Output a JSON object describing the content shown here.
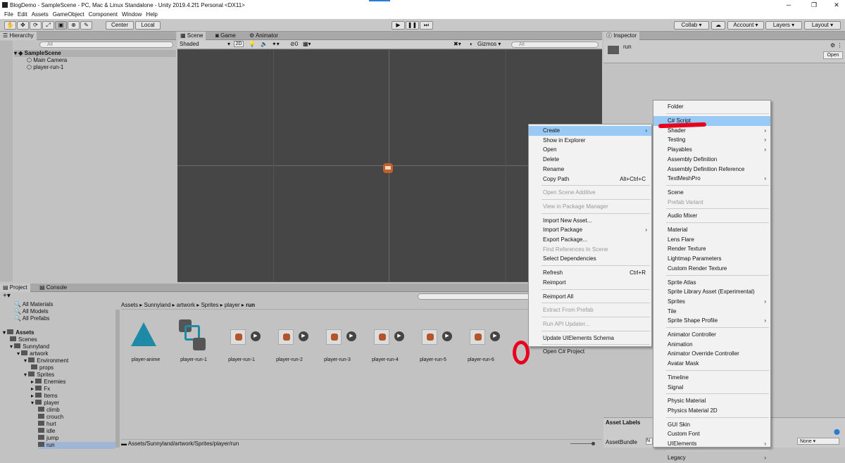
{
  "window": {
    "title": "BlogDemo - SampleScene - PC, Mac & Linux Standalone - Unity 2019.4.2f1 Personal <DX11>",
    "minimize": "─",
    "maximize": "❐",
    "close": "✕"
  },
  "menubar": [
    "File",
    "Edit",
    "Assets",
    "GameObject",
    "Component",
    "Window",
    "Help"
  ],
  "toolbar": {
    "center": "Center",
    "local": "Local",
    "collab": "Collab",
    "account": "Account",
    "layers": "Layers",
    "layout": "Layout"
  },
  "hierarchy": {
    "tab": "Hierarchy",
    "search": "All",
    "scene": "SampleScene",
    "items": [
      "Main Camera",
      "player-run-1"
    ]
  },
  "scene": {
    "tabs": [
      "Scene",
      "Game",
      "Animator"
    ],
    "shading": "Shaded",
    "mode2d": "2D",
    "gizmos": "Gizmos",
    "search": "All",
    "fx": "0"
  },
  "inspector": {
    "tab": "Inspector",
    "name": "run",
    "open": "Open",
    "asset_labels": "Asset Labels",
    "asset_bundle": "AssetBundle",
    "bundle_value": "None"
  },
  "project": {
    "tabs": [
      "Project",
      "Console"
    ],
    "favorites": [
      "All Materials",
      "All Models",
      "All Prefabs"
    ],
    "tree": [
      {
        "label": "Assets",
        "depth": 0
      },
      {
        "label": "Scenes",
        "depth": 1
      },
      {
        "label": "Sunnyland",
        "depth": 1
      },
      {
        "label": "artwork",
        "depth": 2
      },
      {
        "label": "Environment",
        "depth": 3
      },
      {
        "label": "props",
        "depth": 4
      },
      {
        "label": "Sprites",
        "depth": 3
      },
      {
        "label": "Enemies",
        "depth": 4
      },
      {
        "label": "Fx",
        "depth": 4
      },
      {
        "label": "Items",
        "depth": 4
      },
      {
        "label": "player",
        "depth": 4
      },
      {
        "label": "climb",
        "depth": 5
      },
      {
        "label": "crouch",
        "depth": 5
      },
      {
        "label": "hurt",
        "depth": 5
      },
      {
        "label": "idle",
        "depth": 5
      },
      {
        "label": "jump",
        "depth": 5
      },
      {
        "label": "run",
        "depth": 5
      }
    ],
    "breadcrumb": [
      "Assets",
      "Sunnyland",
      "artwork",
      "Sprites",
      "player",
      "run"
    ],
    "path": "Assets/Sunnyland/artwork/Sprites/player/run",
    "assets": [
      "player-anime",
      "player-run-1",
      "player-run-1",
      "player-run-2",
      "player-run-3",
      "player-run-4",
      "player-run-5",
      "player-run-6"
    ]
  },
  "context_menu": [
    {
      "label": "Create",
      "arrow": true,
      "hl": true
    },
    {
      "label": "Show in Explorer"
    },
    {
      "label": "Open"
    },
    {
      "label": "Delete"
    },
    {
      "label": "Rename"
    },
    {
      "label": "Copy Path",
      "shortcut": "Alt+Ctrl+C"
    },
    {
      "sep": true
    },
    {
      "label": "Open Scene Additive",
      "dis": true
    },
    {
      "sep": true
    },
    {
      "label": "View in Package Manager",
      "dis": true
    },
    {
      "sep": true
    },
    {
      "label": "Import New Asset..."
    },
    {
      "label": "Import Package",
      "arrow": true
    },
    {
      "label": "Export Package..."
    },
    {
      "label": "Find References In Scene",
      "dis": true
    },
    {
      "label": "Select Dependencies"
    },
    {
      "sep": true
    },
    {
      "label": "Refresh",
      "shortcut": "Ctrl+R"
    },
    {
      "label": "Reimport"
    },
    {
      "sep": true
    },
    {
      "label": "Reimport All"
    },
    {
      "sep": true
    },
    {
      "label": "Extract From Prefab",
      "dis": true
    },
    {
      "sep": true
    },
    {
      "label": "Run API Updater...",
      "dis": true
    },
    {
      "sep": true
    },
    {
      "label": "Update UIElements Schema"
    },
    {
      "sep": true
    },
    {
      "label": "Open C# Project"
    }
  ],
  "create_menu": [
    {
      "label": "Folder"
    },
    {
      "sep": true
    },
    {
      "label": "C# Script",
      "hl": true
    },
    {
      "label": "Shader",
      "arrow": true
    },
    {
      "label": "Testing",
      "arrow": true
    },
    {
      "label": "Playables",
      "arrow": true
    },
    {
      "label": "Assembly Definition"
    },
    {
      "label": "Assembly Definition Reference"
    },
    {
      "label": "TextMeshPro",
      "arrow": true
    },
    {
      "sep": true
    },
    {
      "label": "Scene"
    },
    {
      "label": "Prefab Variant",
      "dis": true
    },
    {
      "sep": true
    },
    {
      "label": "Audio Mixer"
    },
    {
      "sep": true
    },
    {
      "label": "Material"
    },
    {
      "label": "Lens Flare"
    },
    {
      "label": "Render Texture"
    },
    {
      "label": "Lightmap Parameters"
    },
    {
      "label": "Custom Render Texture"
    },
    {
      "sep": true
    },
    {
      "label": "Sprite Atlas"
    },
    {
      "label": "Sprite Library Asset (Experimental)"
    },
    {
      "label": "Sprites",
      "arrow": true
    },
    {
      "label": "Tile"
    },
    {
      "label": "Sprite Shape Profile",
      "arrow": true
    },
    {
      "sep": true
    },
    {
      "label": "Animator Controller"
    },
    {
      "label": "Animation"
    },
    {
      "label": "Animator Override Controller"
    },
    {
      "label": "Avatar Mask"
    },
    {
      "sep": true
    },
    {
      "label": "Timeline"
    },
    {
      "label": "Signal"
    },
    {
      "sep": true
    },
    {
      "label": "Physic Material"
    },
    {
      "label": "Physics Material 2D"
    },
    {
      "sep": true
    },
    {
      "label": "GUI Skin"
    },
    {
      "label": "Custom Font"
    },
    {
      "label": "UIElements",
      "arrow": true
    },
    {
      "sep": true
    },
    {
      "label": "Legacy",
      "arrow": true
    }
  ],
  "colors": {
    "highlight": "#99c9f5",
    "annotation": "#e8001c",
    "scene_bg": "#464646"
  }
}
